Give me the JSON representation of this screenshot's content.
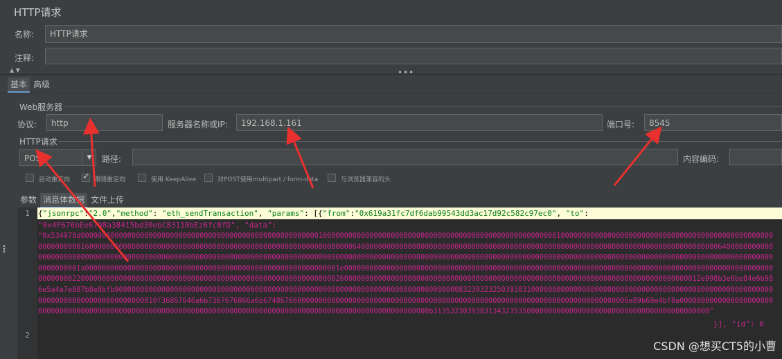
{
  "panel": {
    "title": "HTTP请求"
  },
  "form": {
    "name_label": "名称:",
    "name_value": "HTTP请求",
    "comment_label": "注释:",
    "comment_value": ""
  },
  "top_tabs": {
    "basic": "基本",
    "advanced": "高级"
  },
  "web_server": {
    "group_title": "Web服务器",
    "protocol_label": "协议:",
    "protocol_value": "http",
    "server_label": "服务器名称或IP:",
    "server_value": "192.168.1.161",
    "port_label": "端口号:",
    "port_value": "8545"
  },
  "http_request": {
    "group_title": "HTTP请求",
    "method_value": "POST",
    "path_label": "路径:",
    "path_value": "",
    "encoding_label": "内容编码:",
    "encoding_value": ""
  },
  "checkboxes": [
    {
      "label": "自动重定向",
      "checked": false
    },
    {
      "label": "跟随重定向",
      "checked": true
    },
    {
      "label": "使用 KeepAlive",
      "checked": false
    },
    {
      "label": "对POST使用multipart / form-data",
      "checked": false
    },
    {
      "label": "与浏览器兼容的头",
      "checked": false
    }
  ],
  "body_tabs": {
    "params": "参数",
    "body": "消息体数据",
    "files": "文件上传"
  },
  "editor": {
    "line1_num": "1",
    "line2_num": "2",
    "json_open": "{",
    "k_jsonrpc": "\"jsonrpc\"",
    "colon": ":",
    "v_jsonrpc": "\"2.0\"",
    "comma": ",",
    "k_method": "\"method\"",
    "v_method": "\"eth_sendTransaction\"",
    "k_params": "\"params\"",
    "params_open": "[{",
    "k_from": "\"from\"",
    "v_from": "\"0x619a31fc7df6dab99543dd3ac17d92c582c97ec0\"",
    "k_to": "\"to\"",
    "v_to": "\"0x4F676bEe6798a38415bd30ebC83110bEz6fc8fD\"",
    "k_data": "\"data\"",
    "data_hex": "\"0x534978d000000000000000000000000000000000000000000000000000000001000000000000000000000000000000000000000000000000000000010000000000000000000000000000000000000000000000000000000000001600000000000000000000000000000000000000000000000000000000000000640000000000000000000000000000000000000000000000000000000000000000000000000000000000006400000000000000000000000000000000000000000000000000000000000000000000000000000000000000000000000000000000000000000000000000000000000000000000000000000000000000000000000000000000000000000000000001a000000000000000000000000000000000000000000000000000000000001e00000000000000000000000000000000000000000000000000000000000000000000000000000000000000000000000000000000000002200000000000000000000000000000000000000000000000000000000000026000000000000000000000000000000000000000000000000000000000000000000000000000000000012e998b3e6be84e6b986e5a4a7e987b8e8bfb900000000000000000000000000000000000000000000000000000000000000000000000000000000832303232503938310000000000000000000000000000000000000000000000000000000000000000000000000000000000010f36867646a6b7367676866a6b67486766000000000000000000000000000000000000000000000000000000000000000000000000000006e89b69e4bf8a000000000000000000000000000000000000000000000000000000000000000000000000000000000000000000000000000000000000000000b31353230393831343235350000000000000000000000000000000000000000000\"",
    "tail": "}], \"id\": 6"
  },
  "watermark": "CSDN @想买CT5的小曹"
}
